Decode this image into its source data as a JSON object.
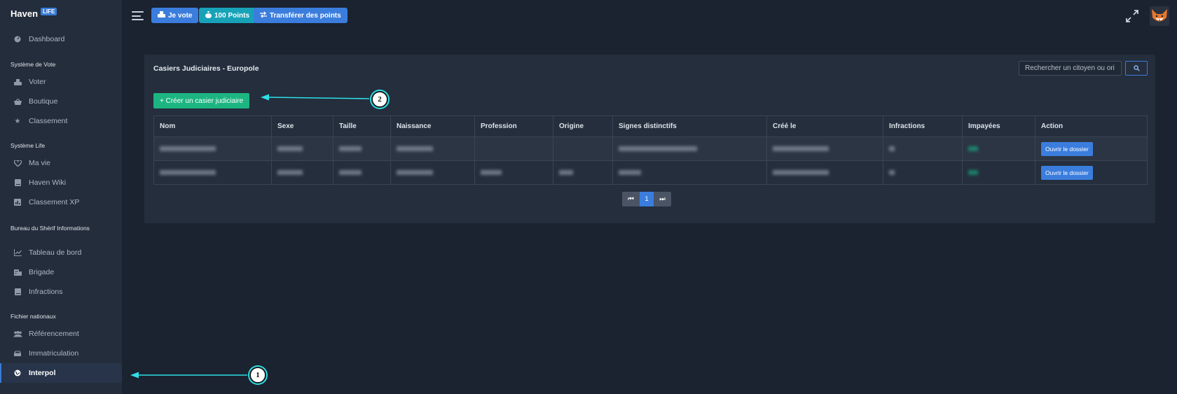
{
  "sidebar": {
    "brand": {
      "name": "Haven",
      "badge": "LIFE"
    },
    "dashboard": "Dashboard",
    "sections": [
      {
        "title": "Système de Vote",
        "items": [
          "Voter",
          "Boutique",
          "Classement"
        ]
      },
      {
        "title": "Système Life",
        "items": [
          "Ma vie",
          "Haven Wiki",
          "Classement XP"
        ]
      },
      {
        "title": "Bureau du Shérif Informations",
        "items": [
          "Tableau de bord",
          "Brigade",
          "Infractions"
        ]
      },
      {
        "title": "Fichier nationaux",
        "items": [
          "Référencement",
          "Immatriculation",
          "Interpol"
        ]
      }
    ],
    "active_item": "Interpol"
  },
  "topbar": {
    "vote_label": "Je vote",
    "points_label": "100 Points",
    "transfer_label": "Transférer des points"
  },
  "card": {
    "title": "Casiers Judiciaires - Europole",
    "search_placeholder": "Rechercher un citoyen ou ori",
    "create_label": "+ Créer un casier judiciaire",
    "columns": [
      "Nom",
      "Sexe",
      "Taille",
      "Naissance",
      "Profession",
      "Origine",
      "Signes distinctifs",
      "Créé le",
      "Infractions",
      "Impayées",
      "Action"
    ],
    "row_action_label": "Ouvrir le dossier",
    "pagination": {
      "first": "⏮",
      "current": "1",
      "last": "⏭"
    }
  },
  "annotations": {
    "marker_1": "1",
    "marker_2": "2"
  },
  "colors": {
    "accent": "#3b7ddd",
    "success": "#1cb581",
    "info": "#17a2b8",
    "annotation": "#2de0e6"
  }
}
